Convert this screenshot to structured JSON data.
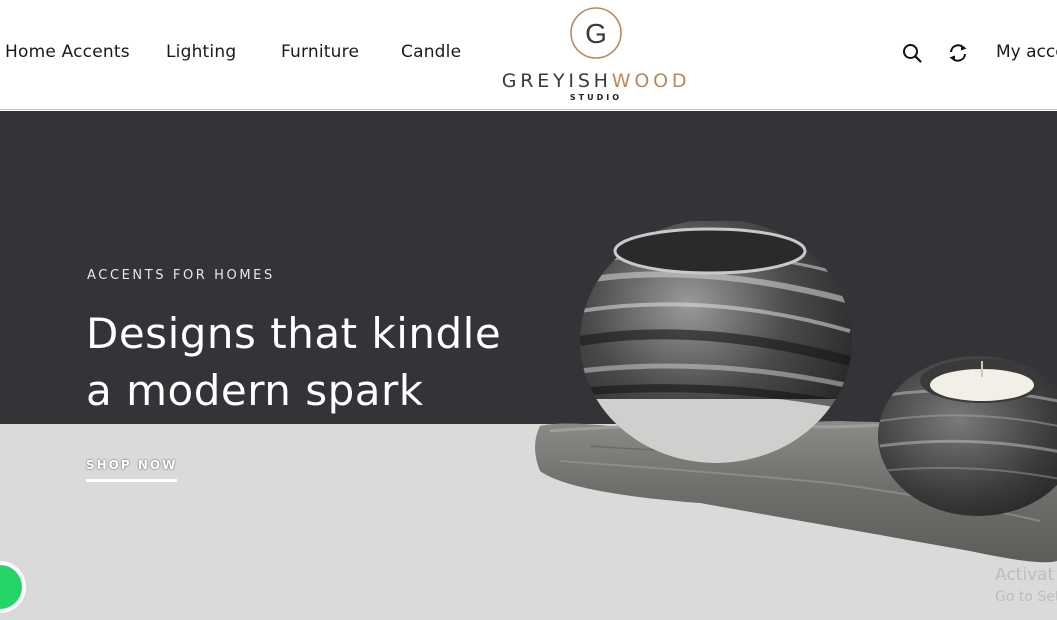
{
  "nav": {
    "items": [
      {
        "label": "Home Accents"
      },
      {
        "label": "Lighting"
      },
      {
        "label": "Furniture"
      },
      {
        "label": "Candle"
      }
    ]
  },
  "logo": {
    "wordmark_part1": "GREYISH",
    "wordmark_part2": "WOOD",
    "subtitle": "STUDIO",
    "monogram": "G",
    "accent_color": "#b9895e"
  },
  "header": {
    "icons": [
      "search-icon",
      "refresh-icon"
    ],
    "account_label": "My acco"
  },
  "hero": {
    "eyebrow": "ACCENTS FOR HOMES",
    "headline_line1": "Designs that kindle",
    "headline_line2": "a modern spark",
    "cta_label": "SHOP NOW",
    "dark_color": "#333338",
    "light_color": "#dadada"
  },
  "overlay": {
    "watermark_line1": "Activat",
    "watermark_line2": "Go to Set"
  },
  "chat_widget": {
    "icon": "whatsapp-icon",
    "color": "#25d366"
  }
}
